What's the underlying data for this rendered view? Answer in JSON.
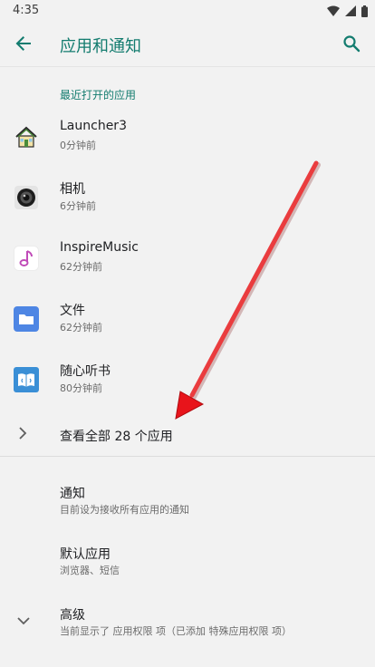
{
  "status_bar": {
    "time": "4:35"
  },
  "header": {
    "title": "应用和通知"
  },
  "recent": {
    "section_title": "最近打开的应用",
    "apps": [
      {
        "name": "Launcher3",
        "subtitle": "0分钟前",
        "icon": "launcher-home-icon"
      },
      {
        "name": "相机",
        "subtitle": "6分钟前",
        "icon": "camera-icon"
      },
      {
        "name": "InspireMusic",
        "subtitle": "62分钟前",
        "icon": "music-note-icon"
      },
      {
        "name": "文件",
        "subtitle": "62分钟前",
        "icon": "folder-icon"
      },
      {
        "name": "随心听书",
        "subtitle": "80分钟前",
        "icon": "audiobook-icon"
      }
    ],
    "see_all_label": "查看全部 28 个应用"
  },
  "settings": [
    {
      "title": "通知",
      "subtitle": "目前设为接收所有应用的通知"
    },
    {
      "title": "默认应用",
      "subtitle": "浏览器、短信"
    },
    {
      "title": "高级",
      "subtitle": "当前显示了 应用权限 项（已添加 特殊应用权限 项）"
    }
  ],
  "colors": {
    "accent": "#137c6f",
    "annotation_arrow": "#e8141b",
    "background": "#f2f2f2"
  }
}
